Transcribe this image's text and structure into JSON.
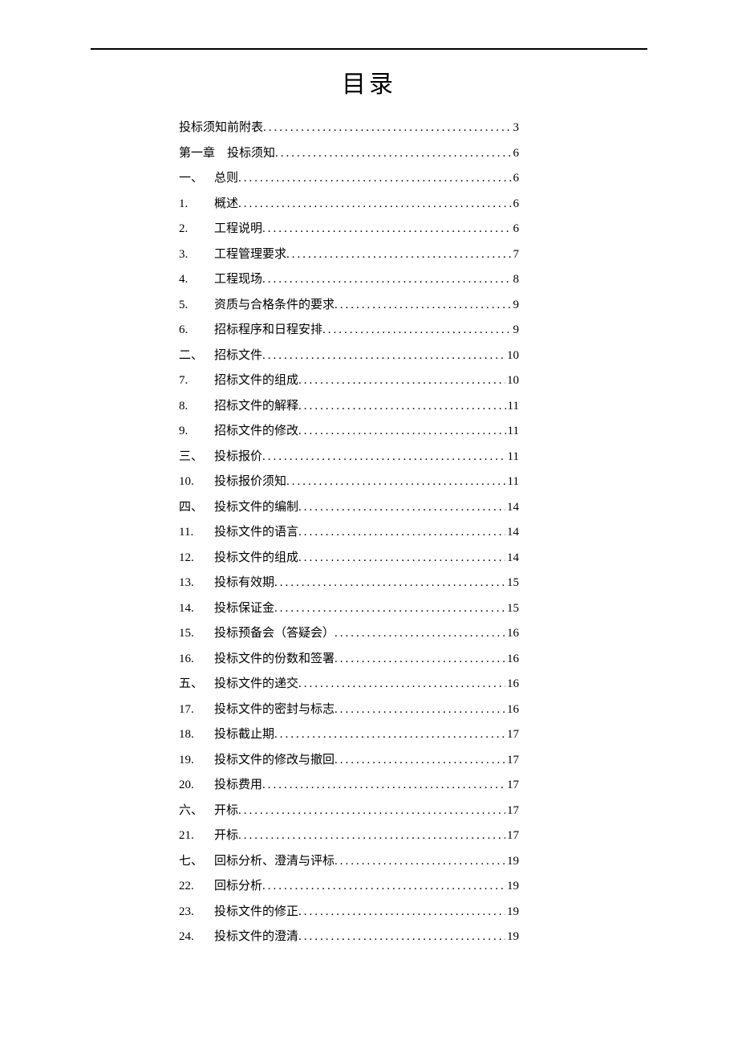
{
  "title": "目录",
  "toc": [
    {
      "num": "",
      "label": "投标须知前附表",
      "page": "3",
      "first": true
    },
    {
      "num": "",
      "label": "第一章　投标须知",
      "page": "6",
      "first": true
    },
    {
      "num": "一、",
      "label": "总则",
      "page": "6"
    },
    {
      "num": "1.",
      "label": "概述",
      "page": "6"
    },
    {
      "num": "2.",
      "label": "工程说明",
      "page": "6"
    },
    {
      "num": "3.",
      "label": "工程管理要求",
      "page": "7"
    },
    {
      "num": "4.",
      "label": "工程现场",
      "page": "8"
    },
    {
      "num": "5.",
      "label": "资质与合格条件的要求",
      "page": "9"
    },
    {
      "num": "6.",
      "label": "招标程序和日程安排",
      "page": "9"
    },
    {
      "num": "二、",
      "label": "招标文件",
      "page": "10"
    },
    {
      "num": "7.",
      "label": "招标文件的组成",
      "page": "10"
    },
    {
      "num": "8.",
      "label": "招标文件的解释",
      "page": "11"
    },
    {
      "num": "9.",
      "label": "招标文件的修改",
      "page": "11"
    },
    {
      "num": "三、",
      "label": "投标报价",
      "page": "11"
    },
    {
      "num": "10.",
      "label": "投标报价须知",
      "page": "11"
    },
    {
      "num": "四、",
      "label": "投标文件的编制",
      "page": "14"
    },
    {
      "num": "11.",
      "label": "投标文件的语言",
      "page": "14"
    },
    {
      "num": "12.",
      "label": "投标文件的组成",
      "page": "14"
    },
    {
      "num": "13.",
      "label": "投标有效期",
      "page": "15"
    },
    {
      "num": "14.",
      "label": "投标保证金",
      "page": "15"
    },
    {
      "num": "15.",
      "label": "投标预备会（答疑会）",
      "page": "16"
    },
    {
      "num": "16.",
      "label": "投标文件的份数和签署",
      "page": "16"
    },
    {
      "num": "五、",
      "label": "投标文件的递交",
      "page": "16"
    },
    {
      "num": "17.",
      "label": "投标文件的密封与标志",
      "page": "16"
    },
    {
      "num": "18.",
      "label": "投标截止期",
      "page": "17"
    },
    {
      "num": "19.",
      "label": "投标文件的修改与撤回",
      "page": "17"
    },
    {
      "num": "20.",
      "label": "投标费用",
      "page": "17"
    },
    {
      "num": "六、",
      "label": "开标",
      "page": "17"
    },
    {
      "num": "21.",
      "label": "开标",
      "page": "17"
    },
    {
      "num": "七、",
      "label": "回标分析、澄清与评标",
      "page": "19"
    },
    {
      "num": "22.",
      "label": "回标分析",
      "page": "19"
    },
    {
      "num": "23.",
      "label": "投标文件的修正",
      "page": "19"
    },
    {
      "num": "24.",
      "label": "投标文件的澄清",
      "page": "19"
    }
  ]
}
